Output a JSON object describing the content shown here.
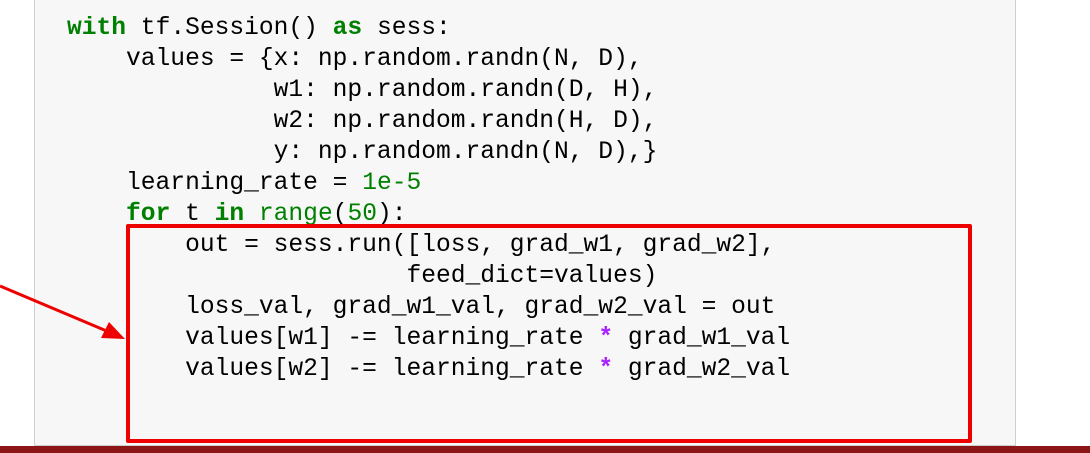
{
  "code": {
    "lines": [
      [
        {
          "t": "with",
          "c": "kw"
        },
        {
          "t": " tf.Session() ",
          "c": ""
        },
        {
          "t": "as",
          "c": "kw"
        },
        {
          "t": " sess:",
          "c": ""
        }
      ],
      [
        {
          "t": "    values = {x: np.random.randn(N, D),",
          "c": ""
        }
      ],
      [
        {
          "t": "              w1: np.random.randn(D, H),",
          "c": ""
        }
      ],
      [
        {
          "t": "              w2: np.random.randn(H, D),",
          "c": ""
        }
      ],
      [
        {
          "t": "              y: np.random.randn(N, D),}",
          "c": ""
        }
      ],
      [
        {
          "t": "    learning_rate = ",
          "c": ""
        },
        {
          "t": "1e-5",
          "c": "num"
        }
      ],
      [
        {
          "t": "    ",
          "c": ""
        },
        {
          "t": "for",
          "c": "kw"
        },
        {
          "t": " t ",
          "c": ""
        },
        {
          "t": "in",
          "c": "kw"
        },
        {
          "t": " ",
          "c": ""
        },
        {
          "t": "range",
          "c": "builtin"
        },
        {
          "t": "(",
          "c": ""
        },
        {
          "t": "50",
          "c": "num"
        },
        {
          "t": "):",
          "c": ""
        }
      ],
      [
        {
          "t": "        out = sess.run([loss, grad_w1, grad_w2],",
          "c": ""
        }
      ],
      [
        {
          "t": "                       feed_dict=values)",
          "c": ""
        }
      ],
      [
        {
          "t": "        loss_val, grad_w1_val, grad_w2_val = out",
          "c": ""
        }
      ],
      [
        {
          "t": "        values[w1] -= learning_rate ",
          "c": ""
        },
        {
          "t": "*",
          "c": "op"
        },
        {
          "t": " grad_w1_val",
          "c": ""
        }
      ],
      [
        {
          "t": "        values[w2] -= learning_rate ",
          "c": ""
        },
        {
          "t": "*",
          "c": "op"
        },
        {
          "t": " grad_w2_val",
          "c": ""
        }
      ]
    ]
  },
  "colors": {
    "keyword": "#008000",
    "operator": "#aa22ff",
    "highlight": "#ee0000",
    "bottom_bar": "#8c1515",
    "code_background": "#f7f7f7"
  }
}
